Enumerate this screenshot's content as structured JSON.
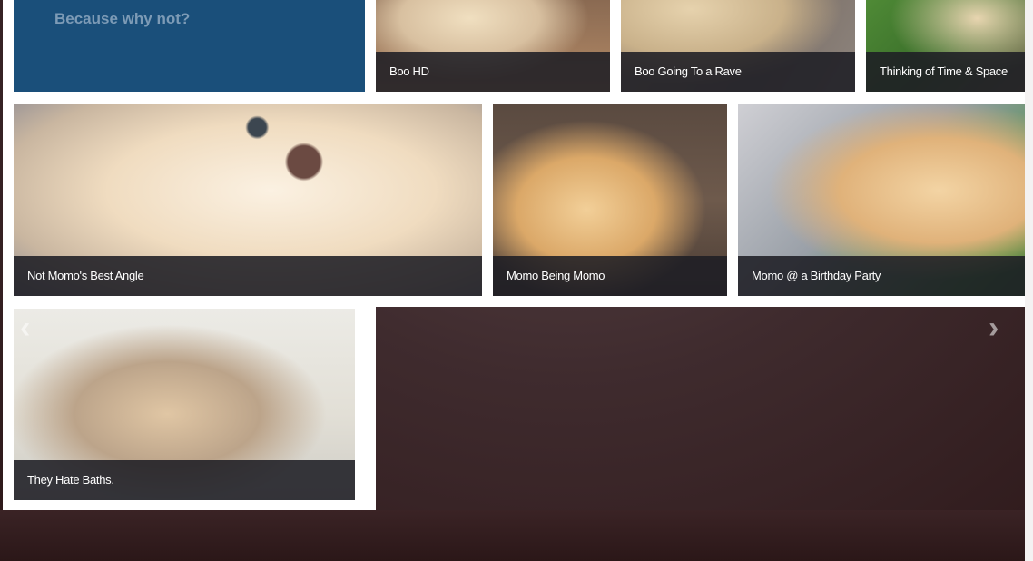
{
  "intro": {
    "tagline": "Because why not?"
  },
  "gallery": {
    "row1": [
      {
        "title": "Boo HD"
      },
      {
        "title": "Boo Going To a Rave"
      },
      {
        "title": "Thinking of Time & Space"
      }
    ],
    "row2": [
      {
        "title": "Not Momo's Best Angle"
      },
      {
        "title": "Momo Being Momo"
      },
      {
        "title": "Momo @ a Birthday Party"
      }
    ],
    "row3": [
      {
        "title": "They Hate Baths."
      }
    ]
  },
  "navigation": {
    "prev_icon": "‹",
    "next_icon": "›"
  },
  "colors": {
    "intro_background": "#1a4f7a",
    "caption_background": "#1e1e24",
    "page_background": "#3f2b2e"
  }
}
